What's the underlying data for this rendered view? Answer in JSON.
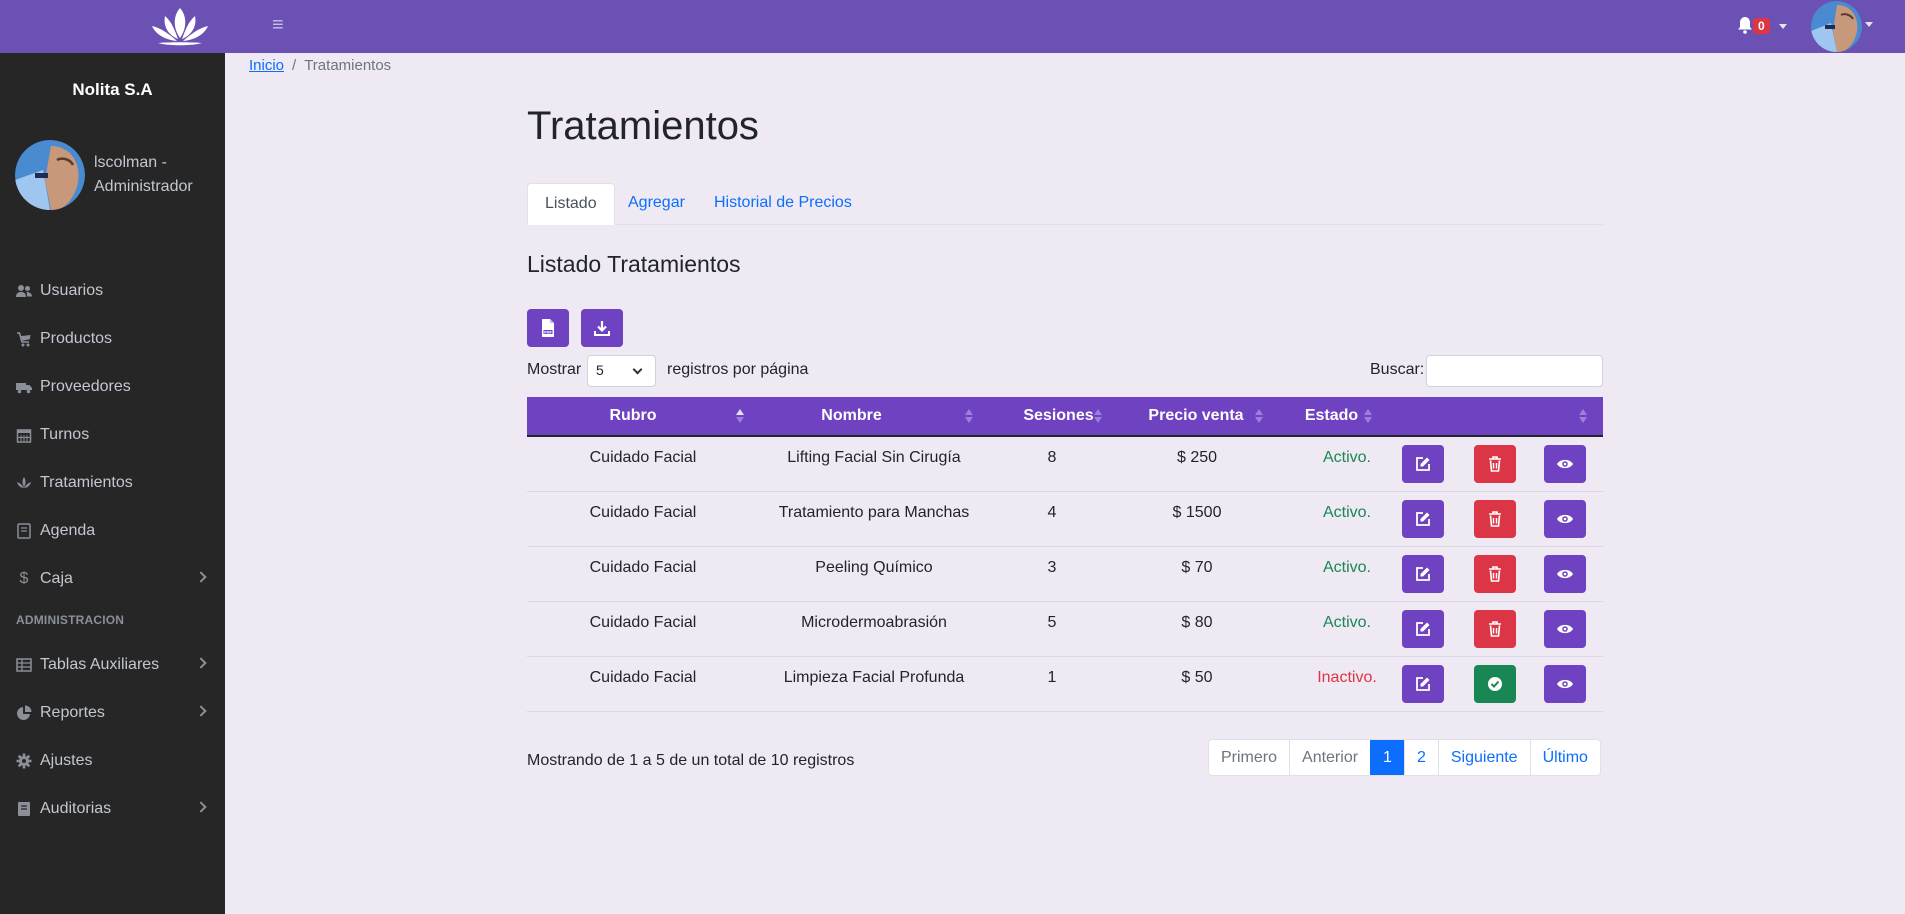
{
  "topbar": {
    "notifications_count": "0",
    "colors": {
      "bar": "#6a51b3",
      "badge": "#dc3545"
    }
  },
  "sidebar": {
    "company": "Nolita S.A",
    "user": "lscolman - Administrador",
    "items": [
      {
        "label": "Usuarios",
        "icon": "users-icon",
        "chevron": false
      },
      {
        "label": "Productos",
        "icon": "cart-icon",
        "chevron": false
      },
      {
        "label": "Proveedores",
        "icon": "truck-icon",
        "chevron": false
      },
      {
        "label": "Turnos",
        "icon": "calendar-icon",
        "chevron": false
      },
      {
        "label": "Tratamientos",
        "icon": "spa-icon",
        "chevron": false
      },
      {
        "label": "Agenda",
        "icon": "book-icon",
        "chevron": false
      },
      {
        "label": "Caja",
        "icon": "dollar-icon",
        "chevron": true
      }
    ],
    "section_header": "ADMINISTRACION",
    "admin_items": [
      {
        "label": "Tablas Auxiliares",
        "icon": "table-icon",
        "chevron": true
      },
      {
        "label": "Reportes",
        "icon": "chart-pie-icon",
        "chevron": true
      },
      {
        "label": "Ajustes",
        "icon": "gear-icon",
        "chevron": false
      },
      {
        "label": "Auditorias",
        "icon": "book-icon",
        "chevron": true
      }
    ]
  },
  "breadcrumb": {
    "home": "Inicio",
    "current": "Tratamientos"
  },
  "main": {
    "title": "Tratamientos",
    "tabs": [
      "Listado",
      "Agregar",
      "Historial de Precios"
    ],
    "section_title": "Listado Tratamientos",
    "toolbar": {
      "pdf_icon": "file-pdf-icon",
      "download_icon": "download-icon"
    },
    "length": {
      "label": "Mostrar",
      "value": "5",
      "suffix": "registros por página"
    },
    "search": {
      "label": "Buscar:",
      "value": ""
    }
  },
  "table": {
    "headers": [
      "Rubro",
      "Nombre",
      "Sesiones",
      "Precio venta",
      "Estado"
    ],
    "rows": [
      {
        "rubro": "Cuidado Facial",
        "nombre": "Lifting Facial Sin Cirugía",
        "sesiones": "8",
        "precio": "$ 250",
        "estado": "Activo.",
        "activo": true
      },
      {
        "rubro": "Cuidado Facial",
        "nombre": "Tratamiento para Manchas",
        "sesiones": "4",
        "precio": "$ 1500",
        "estado": "Activo.",
        "activo": true
      },
      {
        "rubro": "Cuidado Facial",
        "nombre": "Peeling Químico",
        "sesiones": "3",
        "precio": "$ 70",
        "estado": "Activo.",
        "activo": true
      },
      {
        "rubro": "Cuidado Facial",
        "nombre": "Microdermoabrasión",
        "sesiones": "5",
        "precio": "$ 80",
        "estado": "Activo.",
        "activo": true
      },
      {
        "rubro": "Cuidado Facial",
        "nombre": "Limpieza Facial Profunda",
        "sesiones": "1",
        "precio": "$ 50",
        "estado": "Inactivo.",
        "activo": false
      }
    ],
    "colors": {
      "header": "#6f42c1",
      "active": "#198754",
      "inactive": "#dc3545"
    }
  },
  "footer": {
    "info": "Mostrando de 1 a 5 de un total de 10 registros",
    "pager": [
      {
        "label": "Primero",
        "state": "disabled"
      },
      {
        "label": "Anterior",
        "state": "disabled"
      },
      {
        "label": "1",
        "state": "current"
      },
      {
        "label": "2",
        "state": "link"
      },
      {
        "label": "Siguiente",
        "state": "link"
      },
      {
        "label": "Último",
        "state": "link"
      }
    ]
  }
}
